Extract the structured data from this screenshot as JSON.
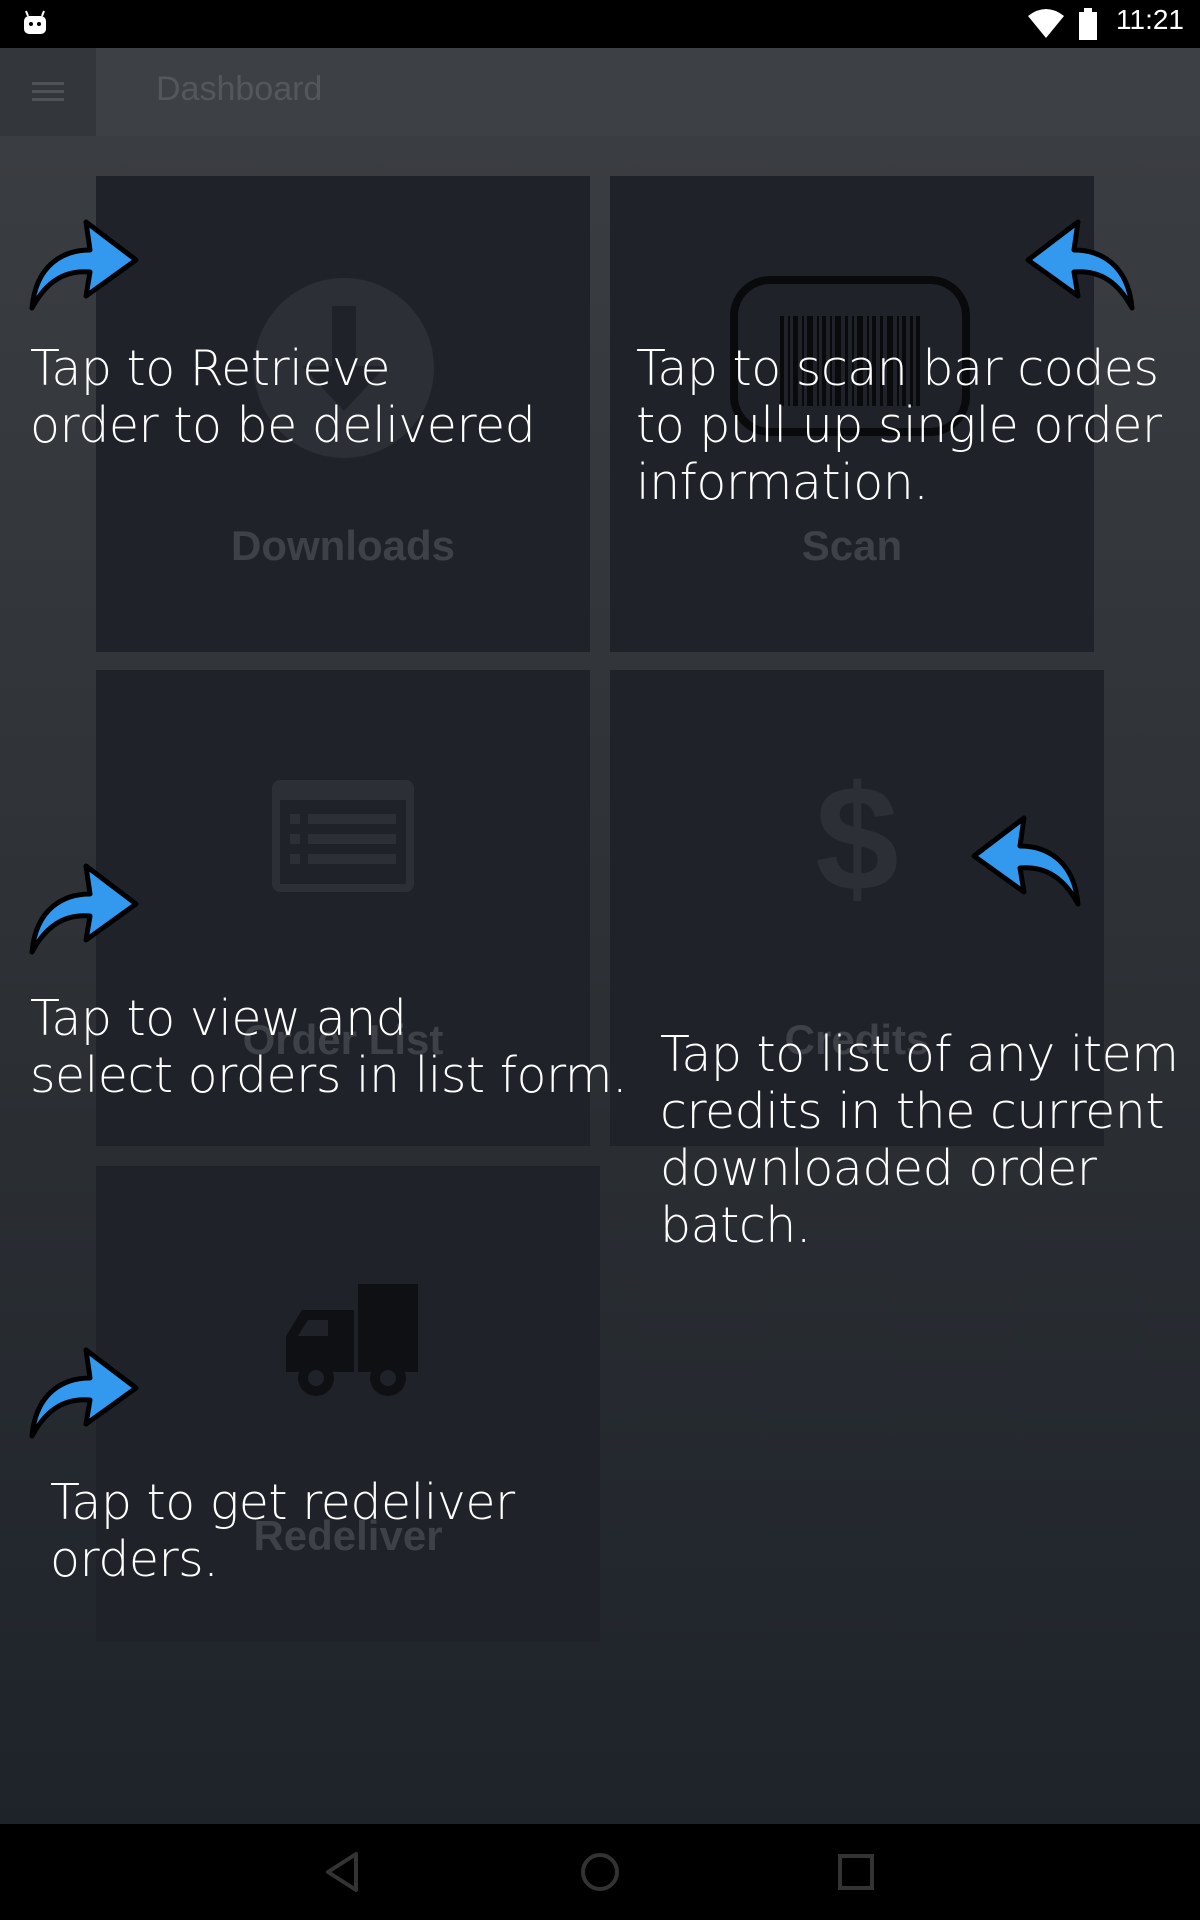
{
  "status_bar": {
    "time": "11:21",
    "icons": [
      "android-icon",
      "wifi-icon",
      "battery-icon"
    ]
  },
  "app_bar": {
    "title": "Dashboard",
    "menu_icon": "hamburger-menu-icon"
  },
  "tiles": [
    {
      "label": "Downloads",
      "icon": "download-icon"
    },
    {
      "label": "Scan",
      "icon": "barcode-icon"
    },
    {
      "label": "Order List",
      "icon": "list-icon"
    },
    {
      "label": "Credits",
      "icon": "dollar-icon"
    },
    {
      "label": "Redeliver",
      "icon": "truck-icon"
    }
  ],
  "hints": {
    "downloads": "Tap to  Retrieve\norder to be delivered",
    "scan": "Tap to scan bar codes\nto pull up single order\ninformation.",
    "order_list": "Tap to view and\nselect orders in list form.",
    "credits": "Tap to list of any item\ncredits in the current\ndownloaded order\nbatch.",
    "redeliver": "Tap to get redeliver\norders."
  },
  "colors": {
    "arrow": "#3399ee",
    "hint_text": "#ffffff",
    "tile_bg": "#1f2329"
  },
  "nav_bar": {
    "buttons": [
      "back-icon",
      "home-icon",
      "recents-icon"
    ]
  }
}
